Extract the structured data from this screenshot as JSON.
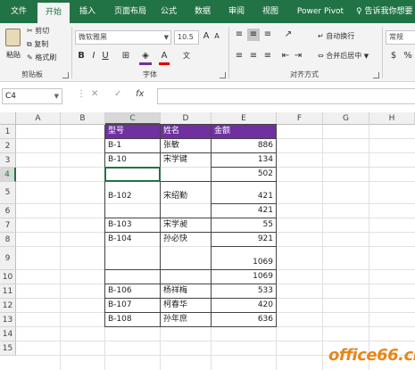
{
  "tabs": [
    "文件",
    "开始",
    "插入",
    "页面布局",
    "公式",
    "数据",
    "审阅",
    "视图",
    "Power Pivot"
  ],
  "tell_me": "告诉我你想要",
  "ribbon": {
    "clipboard": {
      "paste": "粘贴",
      "cut": "剪切",
      "copy": "复制",
      "format_painter": "格式刷",
      "label": "剪贴板"
    },
    "font": {
      "name": "微软雅黑",
      "size": "10.5",
      "label": "字体"
    },
    "alignment": {
      "wrap_text": "自动换行",
      "merge_center": "合并后居中",
      "label": "对齐方式"
    },
    "number": {
      "format": "常规"
    }
  },
  "formula_bar": {
    "name_box": "C4",
    "cancel": "✕",
    "enter": "✓",
    "fx": "fx"
  },
  "columns": [
    "A",
    "B",
    "C",
    "D",
    "E",
    "F",
    "G",
    "H"
  ],
  "rows": [
    "1",
    "2",
    "3",
    "4",
    "5",
    "6",
    "7",
    "8",
    "9",
    "10",
    "11",
    "12",
    "13",
    "14",
    "15"
  ],
  "table": {
    "headers": {
      "c": "型号",
      "d": "姓名",
      "e": "金额"
    },
    "data": [
      {
        "c": "B-1",
        "d": "张敏",
        "e": "886"
      },
      {
        "c": "B-10",
        "d": "宋学键",
        "e": "134"
      },
      {
        "c": "",
        "d": "",
        "e": "502"
      },
      {
        "c": "B-102",
        "d": "宋绍勤",
        "e": "421"
      },
      {
        "c": "",
        "d": "",
        "e": "421"
      },
      {
        "c": "B-103",
        "d": "宋学昶",
        "e": "55"
      },
      {
        "c": "B-104",
        "d": "孙必快",
        "e": "921"
      },
      {
        "c": "",
        "d": "",
        "e": "1069"
      },
      {
        "c": "",
        "d": "",
        "e": "1069"
      },
      {
        "c": "B-106",
        "d": "杨祥梅",
        "e": "533"
      },
      {
        "c": "B-107",
        "d": "柯春华",
        "e": "420"
      },
      {
        "c": "B-108",
        "d": "孙年庶",
        "e": "636"
      }
    ]
  },
  "watermark": "office66.cn"
}
